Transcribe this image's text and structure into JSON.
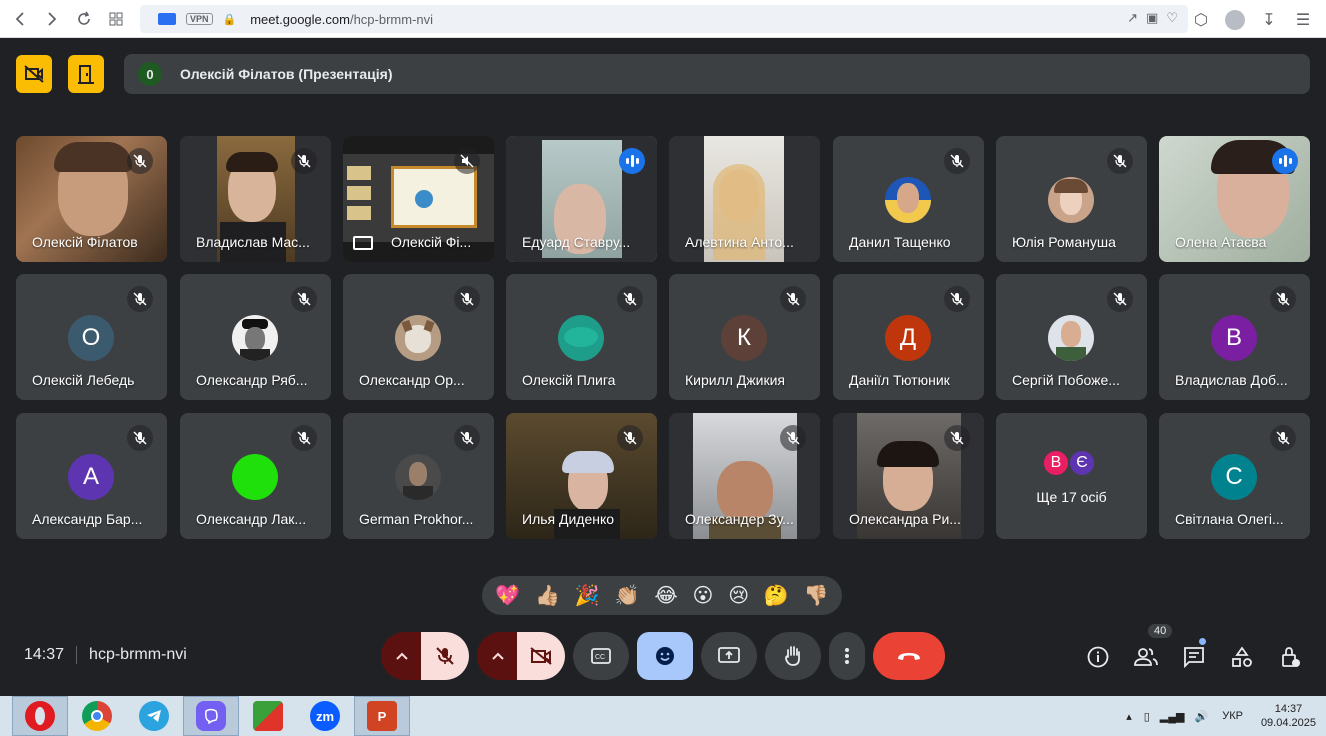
{
  "browser": {
    "url_domain": "meet.google.com",
    "url_path": "/hcp-brmm-nvi",
    "vpn_label": "VPN"
  },
  "presentation": {
    "badge": "0",
    "title": "Олексій Філатов (Презентація)"
  },
  "tiles": [
    {
      "name": "Олексій Філатов"
    },
    {
      "name": "Владислав Мас..."
    },
    {
      "name": "Олексій Фі..."
    },
    {
      "name": "Едуард Ставру..."
    },
    {
      "name": "Алевтина Анто..."
    },
    {
      "name": "Данил Тащенко"
    },
    {
      "name": "Юлія Романуша"
    },
    {
      "name": "Олена Атаєва"
    },
    {
      "name": "Олексій Лебедь",
      "letter": "О",
      "color": "#3c5a6e"
    },
    {
      "name": "Олександр Ряб..."
    },
    {
      "name": "Олександр Ор..."
    },
    {
      "name": "Олексій Плига"
    },
    {
      "name": "Кирилл Джикия",
      "letter": "К",
      "color": "#5d4037"
    },
    {
      "name": "Даніїл Тютюник",
      "letter": "Д",
      "color": "#bf360c"
    },
    {
      "name": "Сергій Побоже..."
    },
    {
      "name": "Владислав Доб...",
      "letter": "В",
      "color": "#7b1fa2"
    },
    {
      "name": "Александр Бар...",
      "letter": "А",
      "color": "#5e35b1"
    },
    {
      "name": "Олександр Лак..."
    },
    {
      "name": "German Prokhor..."
    },
    {
      "name": "Илья Диденко"
    },
    {
      "name": "Олександер Зу..."
    },
    {
      "name": "Олександра Ри..."
    },
    {
      "name": "Ще 17 осіб",
      "avatars": [
        "В",
        "Є"
      ]
    },
    {
      "name": "Світлана Олегі...",
      "letter": "С",
      "color": "#00838f"
    }
  ],
  "reactions": [
    "💖",
    "👍🏼",
    "🎉",
    "👏🏼",
    "😂",
    "😮",
    "😢",
    "🤔",
    "👎🏼"
  ],
  "bottom": {
    "time": "14:37",
    "meeting_code": "hcp-brmm-nvi",
    "participants_count": "40"
  },
  "taskbar": {
    "lang": "УКР",
    "time": "14:37",
    "date": "09.04.2025"
  },
  "colors": {
    "accent_yellow": "#fbbc04",
    "hangup_red": "#ea4335",
    "active_blue": "#8ab4f8",
    "tile_bg": "#3c4043",
    "page_bg": "#202124"
  }
}
